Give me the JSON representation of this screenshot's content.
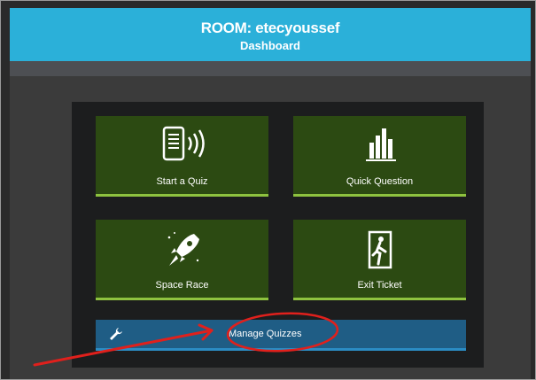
{
  "header": {
    "room_title": "ROOM: etecyoussef",
    "page_title": "Dashboard"
  },
  "tiles": [
    {
      "label": "Start a Quiz",
      "icon": "phone-broadcast-icon"
    },
    {
      "label": "Quick Question",
      "icon": "bar-chart-icon"
    },
    {
      "label": "Space Race",
      "icon": "rocket-icon"
    },
    {
      "label": "Exit Ticket",
      "icon": "exit-door-icon"
    }
  ],
  "manage": {
    "label": "Manage Quizzes",
    "icon": "wrench-icon"
  },
  "colors": {
    "header": "#2bb0d9",
    "tile": "#2c4a12",
    "tile_accent": "#8ec23f",
    "manage": "#1f5d85",
    "annotation": "#e0201c"
  }
}
